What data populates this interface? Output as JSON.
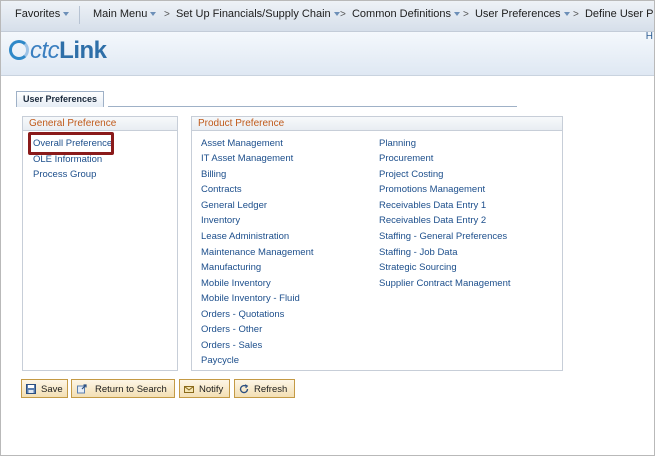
{
  "nav": {
    "favorites": "Favorites",
    "main_menu": "Main Menu",
    "breadcrumbs": [
      "Set Up Financials/Supply Chain",
      "Common Definitions",
      "User Preferences",
      "Define User P"
    ],
    "separator": ">"
  },
  "header": {
    "logo_prefix": "",
    "logo_ctc": "ctc",
    "logo_link": "Link",
    "corner_link": "H"
  },
  "tab": {
    "label": "User Preferences"
  },
  "general_preference": {
    "title": "General Preference",
    "items": [
      "Overall Preference",
      "OLE Information",
      "Process Group"
    ]
  },
  "product_preference": {
    "title": "Product Preference",
    "col1": [
      "Asset Management",
      "IT Asset Management",
      "Billing",
      "Contracts",
      "General Ledger",
      "Inventory",
      "Lease Administration",
      "Maintenance Management",
      "Manufacturing",
      "Mobile Inventory",
      "Mobile Inventory - Fluid",
      "Orders - Quotations",
      "Orders - Other",
      "Orders - Sales",
      "Paycycle"
    ],
    "col2": [
      "Planning",
      "Procurement",
      "Project Costing",
      "Promotions Management",
      "Receivables Data Entry 1",
      "Receivables Data Entry 2",
      "Staffing - General Preferences",
      "Staffing - Job Data",
      "Strategic Sourcing",
      "Supplier Contract Management"
    ]
  },
  "buttons": {
    "save": "Save",
    "return_to_search": "Return to Search",
    "notify": "Notify",
    "refresh": "Refresh"
  },
  "colors": {
    "accent": "#1d4f8c",
    "highlight": "#8a1a1a",
    "group_title": "#c05a1b"
  }
}
